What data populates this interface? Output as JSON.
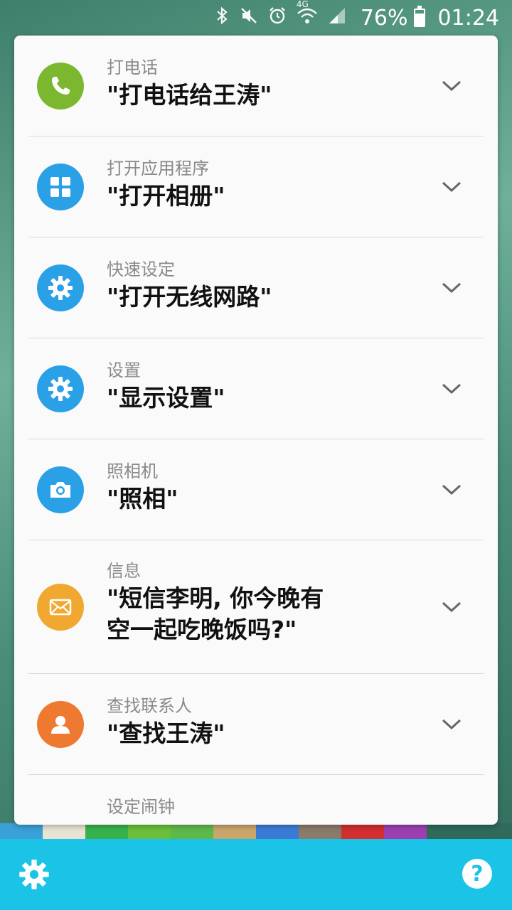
{
  "status_bar": {
    "battery_percent": "76%",
    "time": "01:24",
    "network": "4G",
    "icons": [
      "bluetooth-icon",
      "mute-icon",
      "alarm-icon",
      "wifi-icon",
      "signal-icon",
      "battery-icon"
    ]
  },
  "commands": [
    {
      "category": "打电话",
      "command": "\"打电话给王涛\"",
      "icon": "phone-icon",
      "color": "#7cb82f"
    },
    {
      "category": "打开应用程序",
      "command": "\"打开相册\"",
      "icon": "apps-grid-icon",
      "color": "#2aa0e6"
    },
    {
      "category": "快速设定",
      "command": "\"打开无线网路\"",
      "icon": "gear-icon",
      "color": "#2aa0e6"
    },
    {
      "category": "设置",
      "command": "\"显示设置\"",
      "icon": "gear-icon",
      "color": "#2aa0e6"
    },
    {
      "category": "照相机",
      "command": "\"照相\"",
      "icon": "camera-icon",
      "color": "#2aa0e6"
    },
    {
      "category": "信息",
      "command": "\"短信李明, 你今晚有\n空一起吃晚饭吗?\"",
      "icon": "message-icon",
      "color": "#f0a830"
    },
    {
      "category": "查找联系人",
      "command": "\"查找王涛\"",
      "icon": "contact-icon",
      "color": "#ee7a32"
    },
    {
      "category": "设定闹钟",
      "command": "",
      "icon": "",
      "color": ""
    }
  ],
  "bottom_bar": {
    "settings_icon": "gear-icon",
    "help_label": "?"
  },
  "colors": {
    "accent": "#1bc4e6",
    "panel": "#fafafa"
  }
}
